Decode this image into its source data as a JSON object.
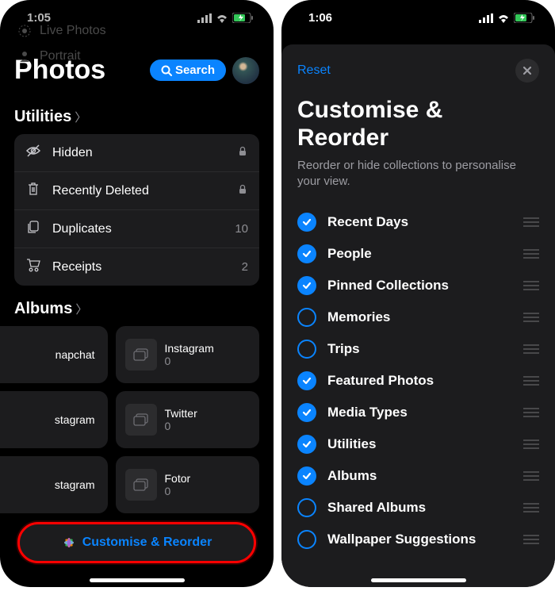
{
  "left": {
    "time": "1:05",
    "ghost": {
      "live": "Live Photos",
      "portrait": "Portrait"
    },
    "app_title": "Photos",
    "search_label": "Search",
    "utilities_header": "Utilities",
    "utilities": [
      {
        "icon": "eye-slash-icon",
        "label": "Hidden",
        "meta_icon": "lock-icon"
      },
      {
        "icon": "trash-icon",
        "label": "Recently Deleted",
        "meta_icon": "lock-icon"
      },
      {
        "icon": "duplicates-icon",
        "label": "Duplicates",
        "meta": "10"
      },
      {
        "icon": "receipt-icon",
        "label": "Receipts",
        "meta": "2"
      }
    ],
    "albums_header": "Albums",
    "albums_left": [
      {
        "label": "napchat"
      },
      {
        "label": "stagram"
      },
      {
        "label": "stagram"
      }
    ],
    "albums_right": [
      {
        "label": "Instagram",
        "count": "0"
      },
      {
        "label": "Twitter",
        "count": "0"
      },
      {
        "label": "Fotor",
        "count": "0"
      }
    ],
    "customize_label": "Customise & Reorder"
  },
  "right": {
    "time": "1:06",
    "reset_label": "Reset",
    "title": "Customise & Reorder",
    "subtitle": "Reorder or hide collections to personalise your view.",
    "options": [
      {
        "label": "Recent Days",
        "checked": true
      },
      {
        "label": "People",
        "checked": true
      },
      {
        "label": "Pinned Collections",
        "checked": true
      },
      {
        "label": "Memories",
        "checked": false
      },
      {
        "label": "Trips",
        "checked": false
      },
      {
        "label": "Featured Photos",
        "checked": true
      },
      {
        "label": "Media Types",
        "checked": true
      },
      {
        "label": "Utilities",
        "checked": true
      },
      {
        "label": "Albums",
        "checked": true
      },
      {
        "label": "Shared Albums",
        "checked": false
      },
      {
        "label": "Wallpaper Suggestions",
        "checked": false
      }
    ]
  }
}
